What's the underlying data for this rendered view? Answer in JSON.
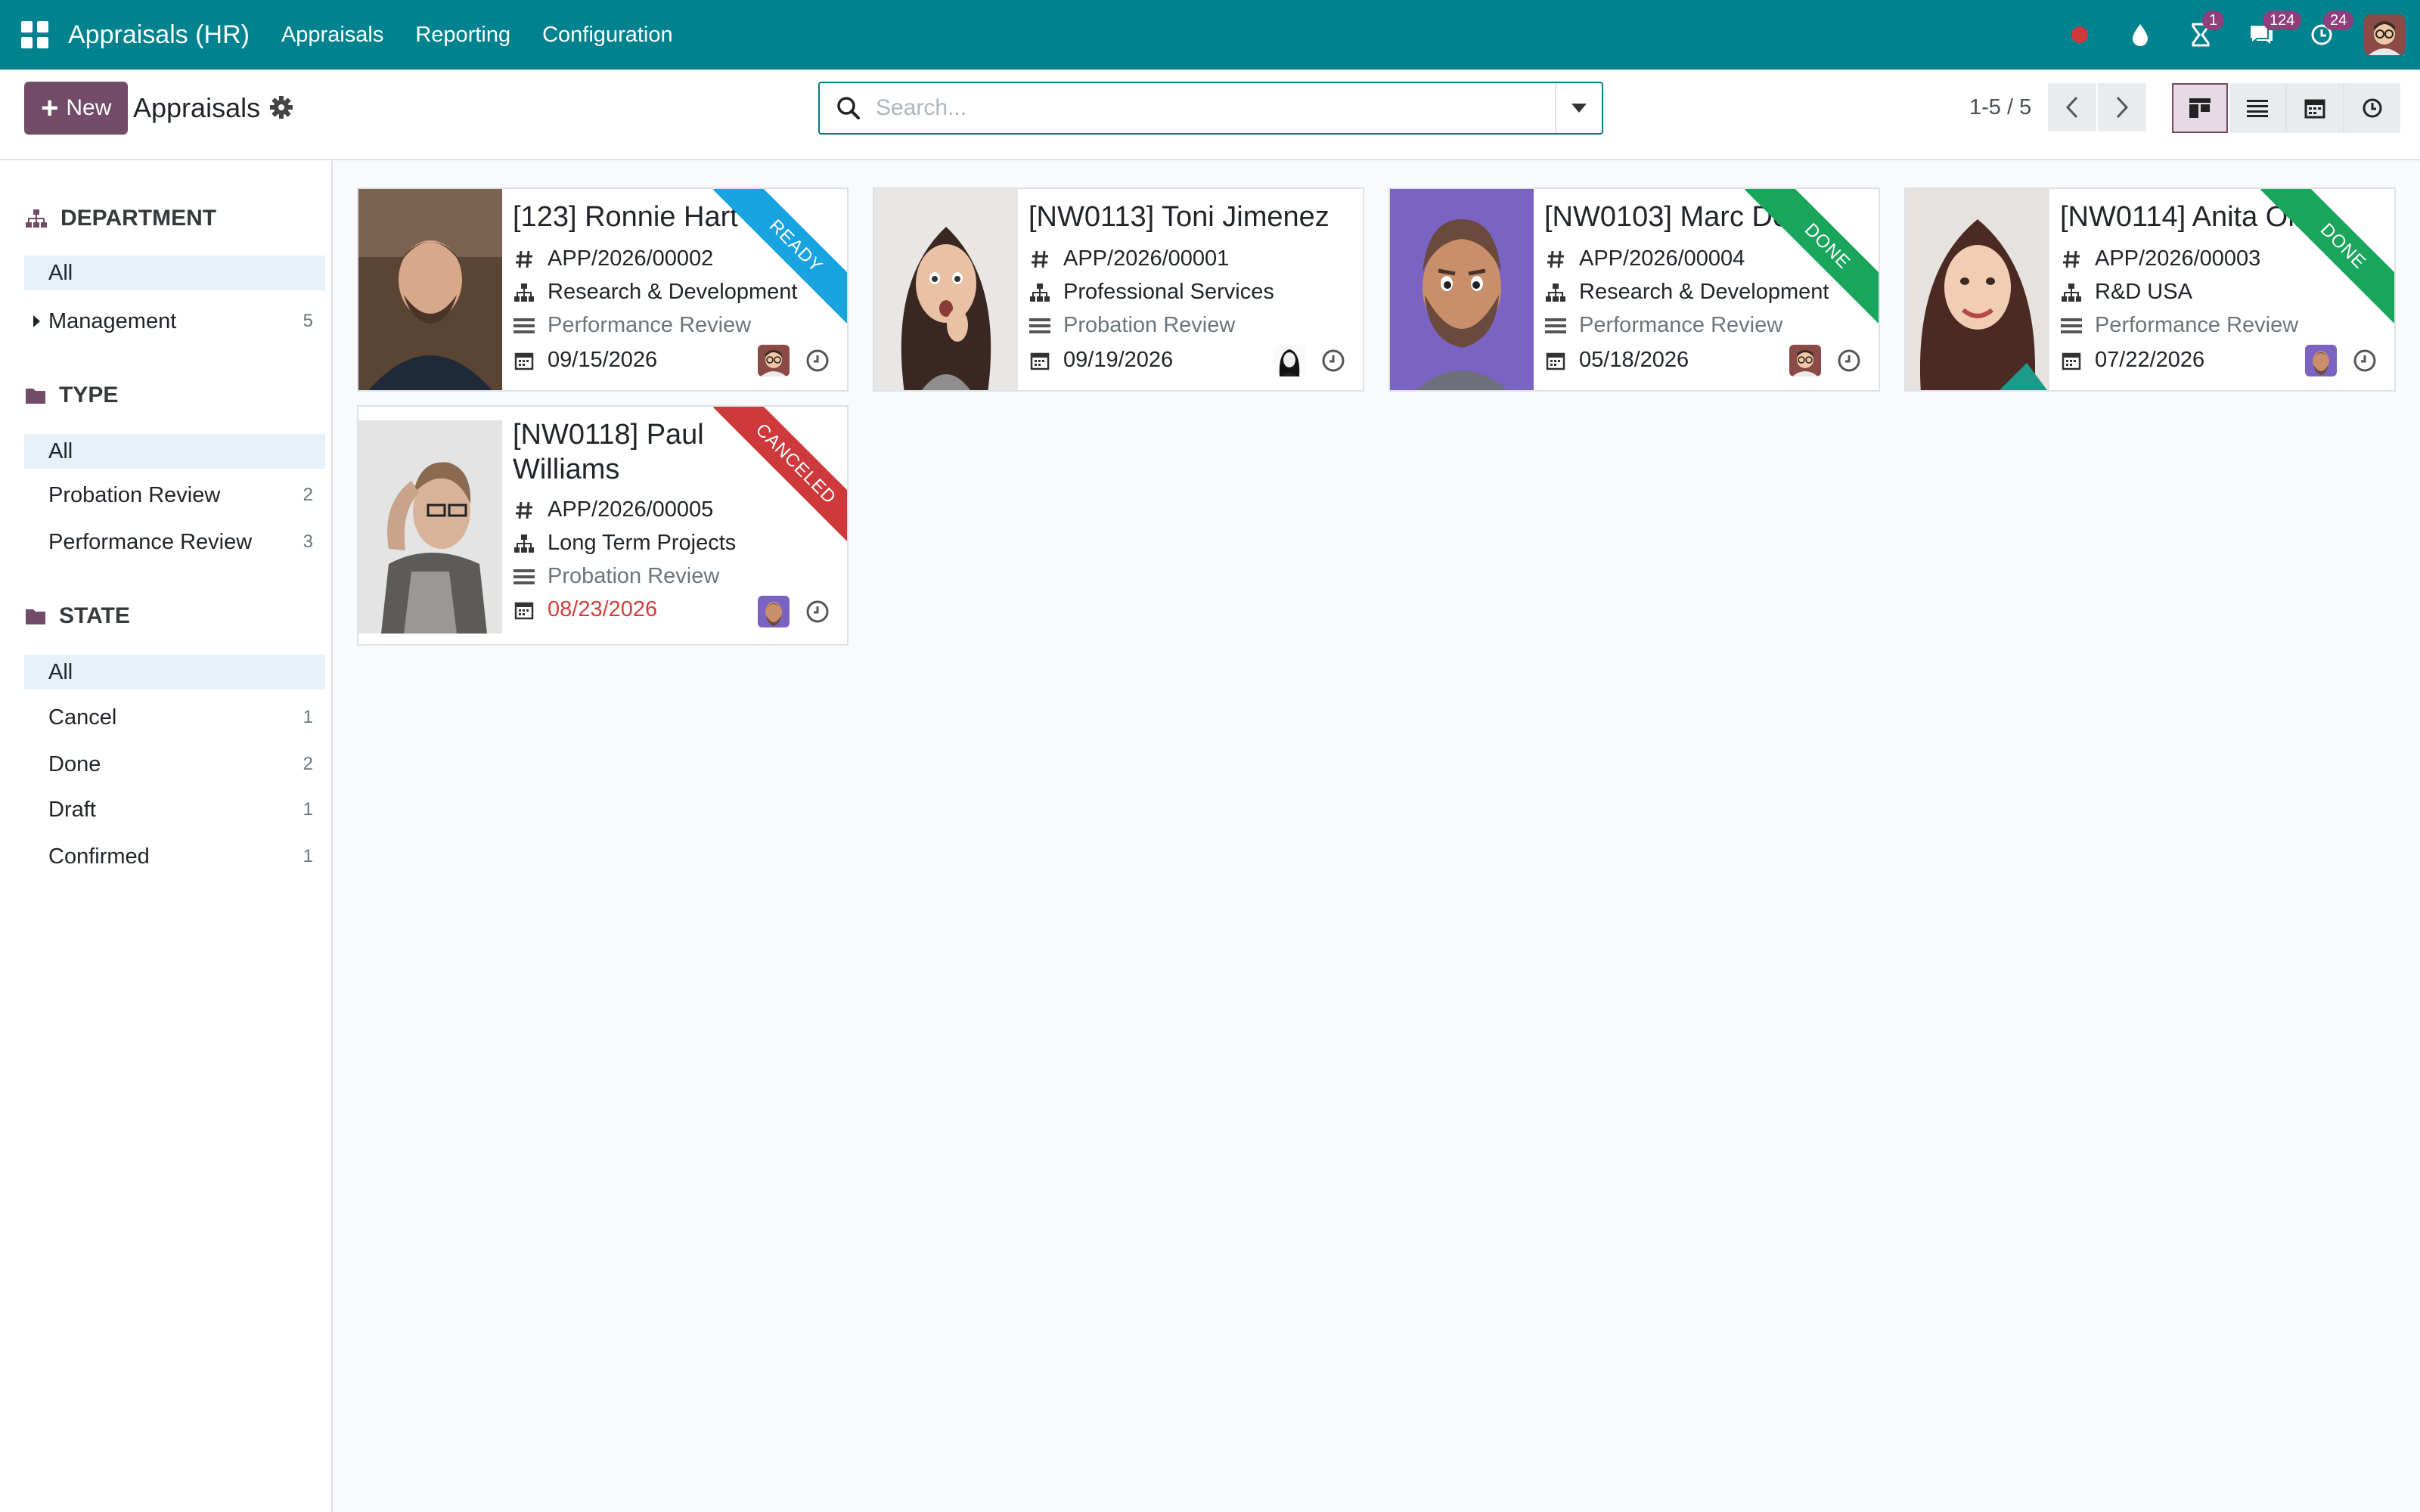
{
  "topbar": {
    "app_title": "Appraisals (HR)",
    "menu": [
      "Appraisals",
      "Reporting",
      "Configuration"
    ],
    "badges": {
      "activities": "1",
      "messages": "124",
      "timesheets": "24"
    }
  },
  "control": {
    "new_label": "New",
    "title": "Appraisals",
    "search_placeholder": "Search...",
    "pager": "1-5 / 5"
  },
  "sidebar": {
    "department": {
      "heading": "DEPARTMENT",
      "items": [
        {
          "label": "All",
          "count": ""
        },
        {
          "label": "Management",
          "count": "5"
        }
      ]
    },
    "type": {
      "heading": "TYPE",
      "items": [
        {
          "label": "All",
          "count": ""
        },
        {
          "label": "Probation Review",
          "count": "2"
        },
        {
          "label": "Performance Review",
          "count": "3"
        }
      ]
    },
    "state": {
      "heading": "STATE",
      "items": [
        {
          "label": "All",
          "count": ""
        },
        {
          "label": "Cancel",
          "count": "1"
        },
        {
          "label": "Done",
          "count": "2"
        },
        {
          "label": "Draft",
          "count": "1"
        },
        {
          "label": "Confirmed",
          "count": "1"
        }
      ]
    }
  },
  "cards": [
    {
      "name": "[123] Ronnie Hart",
      "ref": "APP/2026/00002",
      "department": "Research & Development",
      "type": "Performance Review",
      "date": "09/15/2026",
      "ribbon": "READY"
    },
    {
      "name": "[NW0113] Toni Jimenez",
      "ref": "APP/2026/00001",
      "department": "Professional Services",
      "type": "Probation Review",
      "date": "09/19/2026",
      "ribbon": ""
    },
    {
      "name": "[NW0103] Marc De",
      "ref": "APP/2026/00004",
      "department": "Research & Development",
      "type": "Performance Review",
      "date": "05/18/2026",
      "ribbon": "DONE"
    },
    {
      "name": "[NW0114] Anita Oli",
      "ref": "APP/2026/00003",
      "department": "R&D USA",
      "type": "Performance Review",
      "date": "07/22/2026",
      "ribbon": "DONE"
    },
    {
      "name": "[NW0118] Paul Williams",
      "ref": "APP/2026/00005",
      "department": "Long Term Projects",
      "type": "Probation Review",
      "date": "08/23/2026",
      "ribbon": "CANCELED"
    }
  ],
  "colors": {
    "navbar": "#00838f",
    "primary": "#714b67",
    "ribbon_ready": "#17a2e0",
    "ribbon_done": "#19a65c",
    "ribbon_canceled": "#d0393b",
    "overdue": "#d23f3a"
  }
}
